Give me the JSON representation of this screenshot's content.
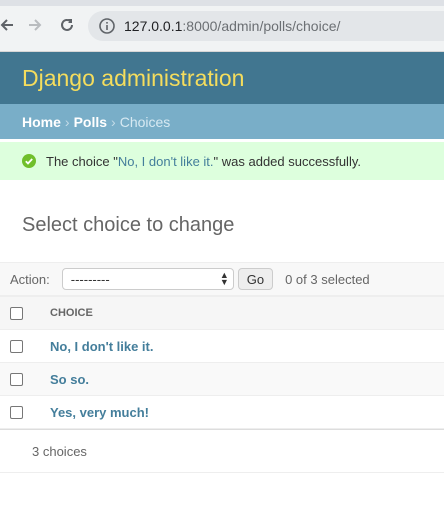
{
  "browser": {
    "url_host": "127.0.0.1",
    "url_rest": ":8000/admin/polls/choice/"
  },
  "header": {
    "brand": "Django administration"
  },
  "breadcrumbs": {
    "home": "Home",
    "app": "Polls",
    "sep": "›",
    "current": "Choices"
  },
  "message": {
    "prefix": "The choice \"",
    "link": "No, I don't like it.",
    "suffix": "\" was added successfully."
  },
  "page_title": "Select choice to change",
  "actions": {
    "label": "Action:",
    "selected_value": "---------",
    "go_label": "Go",
    "counter": "0 of 3 selected"
  },
  "table": {
    "columns": [
      "Choice"
    ],
    "rows": [
      {
        "choice": "No, I don't like it."
      },
      {
        "choice": "So so."
      },
      {
        "choice": "Yes, very much!"
      }
    ]
  },
  "paginator": {
    "text": "3 choices"
  },
  "colors": {
    "header_bg": "#417690",
    "brand": "#f5dd5d",
    "breadcrumbs_bg": "#79aec8",
    "success_bg": "#dfd",
    "link": "#447e9b"
  }
}
